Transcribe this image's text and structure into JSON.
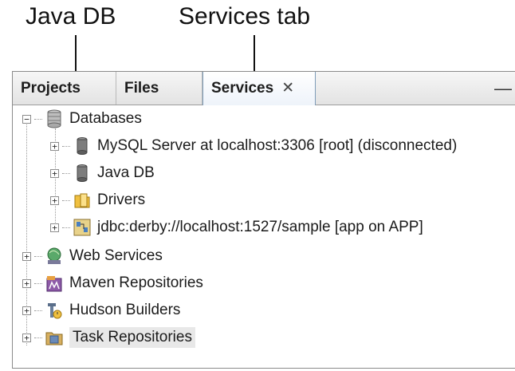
{
  "callouts": {
    "java_db": "Java DB",
    "services_tab": "Services tab"
  },
  "tabs": [
    {
      "label": "Projects"
    },
    {
      "label": "Files"
    },
    {
      "label": "Services",
      "close": "✕",
      "active": true
    }
  ],
  "window_controls": {
    "minimize": "—"
  },
  "tree": {
    "databases": {
      "label": "Databases",
      "expander": "−",
      "children": [
        {
          "label": "MySQL Server at localhost:3306 [root] (disconnected)",
          "icon": "database-server-icon",
          "expander": "+"
        },
        {
          "label": "Java DB",
          "icon": "database-server-icon",
          "expander": "+"
        },
        {
          "label": "Drivers",
          "icon": "folder-icon",
          "expander": "+"
        },
        {
          "label": "jdbc:derby://localhost:1527/sample [app on APP]",
          "icon": "connection-icon",
          "expander": "+"
        }
      ]
    },
    "web_services": {
      "label": "Web Services",
      "icon": "web-services-icon",
      "expander": "+"
    },
    "maven_repositories": {
      "label": "Maven Repositories",
      "icon": "maven-icon",
      "expander": "+"
    },
    "hudson_builders": {
      "label": "Hudson Builders",
      "icon": "hudson-icon",
      "expander": "+"
    },
    "task_repositories": {
      "label": "Task Repositories",
      "icon": "task-repository-icon",
      "expander": "+"
    }
  }
}
